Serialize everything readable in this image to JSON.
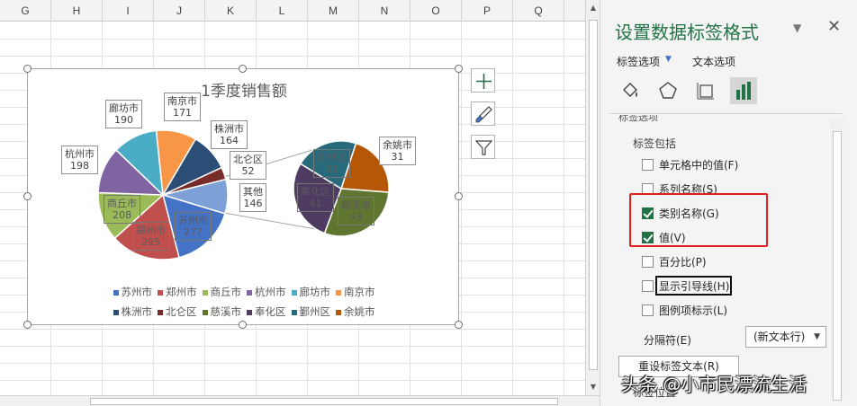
{
  "sheet": {
    "columns": [
      "G",
      "H",
      "I",
      "J",
      "K",
      "L",
      "M",
      "N",
      "O",
      "P",
      "Q"
    ]
  },
  "chart": {
    "title": "1季度销售额",
    "colors": {
      "苏州市": "#4472c4",
      "郑州市": "#c0504d",
      "商丘市": "#9bbb59",
      "杭州市": "#8064a2",
      "廊坊市": "#4bacc6",
      "南京市": "#f79646",
      "株洲市": "#2c4d75",
      "北仑区": "#772c2a",
      "慈溪市": "#5f7530",
      "奉化区": "#4d3b62",
      "鄞州区": "#276a7c",
      "余姚市": "#b65708",
      "其他": "#7ea0d8"
    },
    "legend_row1": [
      {
        "name": "苏州市",
        "icon": "square-swatch"
      },
      {
        "name": "郑州市",
        "icon": "square-swatch"
      },
      {
        "name": "商丘市",
        "icon": "square-swatch"
      },
      {
        "name": "杭州市",
        "icon": "square-swatch"
      },
      {
        "name": "廊坊市",
        "icon": "square-swatch"
      },
      {
        "name": "南京市",
        "icon": "square-swatch"
      }
    ],
    "legend_row2": [
      {
        "name": "株洲市",
        "icon": "square-swatch"
      },
      {
        "name": "北仑区",
        "icon": "square-swatch"
      },
      {
        "name": "慈溪市",
        "icon": "square-swatch"
      },
      {
        "name": "奉化区",
        "icon": "square-swatch"
      },
      {
        "name": "鄞州区",
        "icon": "square-swatch"
      },
      {
        "name": "余姚市",
        "icon": "square-swatch"
      }
    ],
    "side_buttons": [
      "add-element-icon",
      "brush-style-icon",
      "filter-icon"
    ]
  },
  "chart_data": {
    "type": "pie",
    "title": "1季度销售额",
    "main_pie": [
      {
        "label": "苏州市",
        "value": 277
      },
      {
        "label": "郑州市",
        "value": 295
      },
      {
        "label": "商丘市",
        "value": 208
      },
      {
        "label": "杭州市",
        "value": 198
      },
      {
        "label": "廊坊市",
        "value": 190
      },
      {
        "label": "南京市",
        "value": 171
      },
      {
        "label": "株洲市",
        "value": 164
      },
      {
        "label": "北仑区",
        "value": 52
      },
      {
        "label": "其他",
        "value": 146
      }
    ],
    "secondary_pie": [
      {
        "label": "余姚市",
        "value": 31
      },
      {
        "label": "慈溪市",
        "value": 43
      },
      {
        "label": "奉化区",
        "value": 41
      },
      {
        "label": "鄞州区",
        "value": 31
      }
    ],
    "legend_placement": "bottom"
  },
  "pane": {
    "title": "设置数据标签格式",
    "tab_label_options": "标签选项",
    "tab_text_options": "文本选项",
    "section_partial": "标签选项",
    "section_label": "标签包括",
    "options": [
      {
        "label": "单元格中的值(F)",
        "checked": false
      },
      {
        "label": "系列名称(S)",
        "checked": false
      },
      {
        "label": "类别名称(G)",
        "checked": true
      },
      {
        "label": "值(V)",
        "checked": true
      },
      {
        "label": "百分比(P)",
        "checked": false
      },
      {
        "label": "显示引导线(H)",
        "checked": false
      },
      {
        "label": "图例项标示(L)",
        "checked": false
      }
    ],
    "separator_label": "分隔符(E)",
    "separator_value": "(新文本行)",
    "reset_button": "重设标签文本(R)",
    "partial_bottom": "标签位置",
    "icons": [
      "fill-bucket-icon",
      "pentagon-icon",
      "size-properties-icon",
      "bar-chart-icon"
    ]
  },
  "watermark": "头条 @小市民漂流生活"
}
